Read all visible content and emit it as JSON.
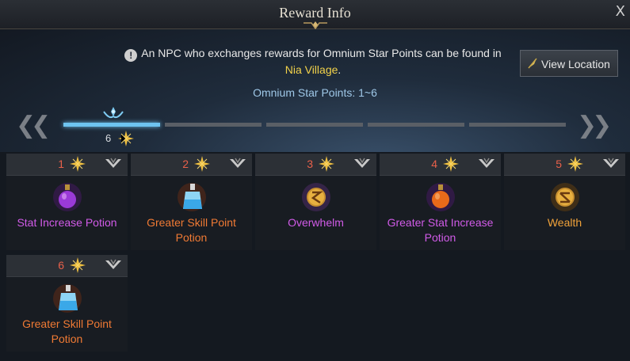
{
  "window": {
    "title": "Reward Info",
    "close_label": "X"
  },
  "notice": {
    "text": "An NPC who exchanges rewards for Omnium Star Points can be found in",
    "location_name": "Nia Village",
    "location_suffix": ".",
    "icon": "info-icon"
  },
  "view_location": {
    "label": "View Location",
    "icon": "pin-icon"
  },
  "range_label": "Omnium Star Points: 1~6",
  "navigation": {
    "first": "first-arrow-icon",
    "prev": "prev-arrow-icon",
    "next": "next-arrow-icon",
    "last": "last-arrow-icon"
  },
  "progress": {
    "segments": 5,
    "filled_segments": 1,
    "current_points": "6"
  },
  "colors": {
    "accent": "#6ec4f0",
    "number": "#e8604a",
    "epic": "#d15be8",
    "legendary": "#f07a34",
    "relic_gold": "#f0a23a",
    "village": "#f2d24a"
  },
  "rewards": [
    {
      "points": "1",
      "name": "Stat Increase Potion",
      "grade": "epic",
      "icon": "purple-potion-icon"
    },
    {
      "points": "2",
      "name": "Greater Skill Point Potion",
      "grade": "legendary",
      "icon": "blue-potion-icon"
    },
    {
      "points": "3",
      "name": "Overwhelm",
      "grade": "epic",
      "icon": "rune-icon"
    },
    {
      "points": "4",
      "name": "Greater Stat Increase Potion",
      "grade": "epic",
      "icon": "orange-potion-icon"
    },
    {
      "points": "5",
      "name": "Wealth",
      "grade": "gold",
      "icon": "rune-icon"
    },
    {
      "points": "6",
      "name": "Greater Skill Point Potion",
      "grade": "legendary",
      "icon": "blue-potion-icon"
    }
  ]
}
